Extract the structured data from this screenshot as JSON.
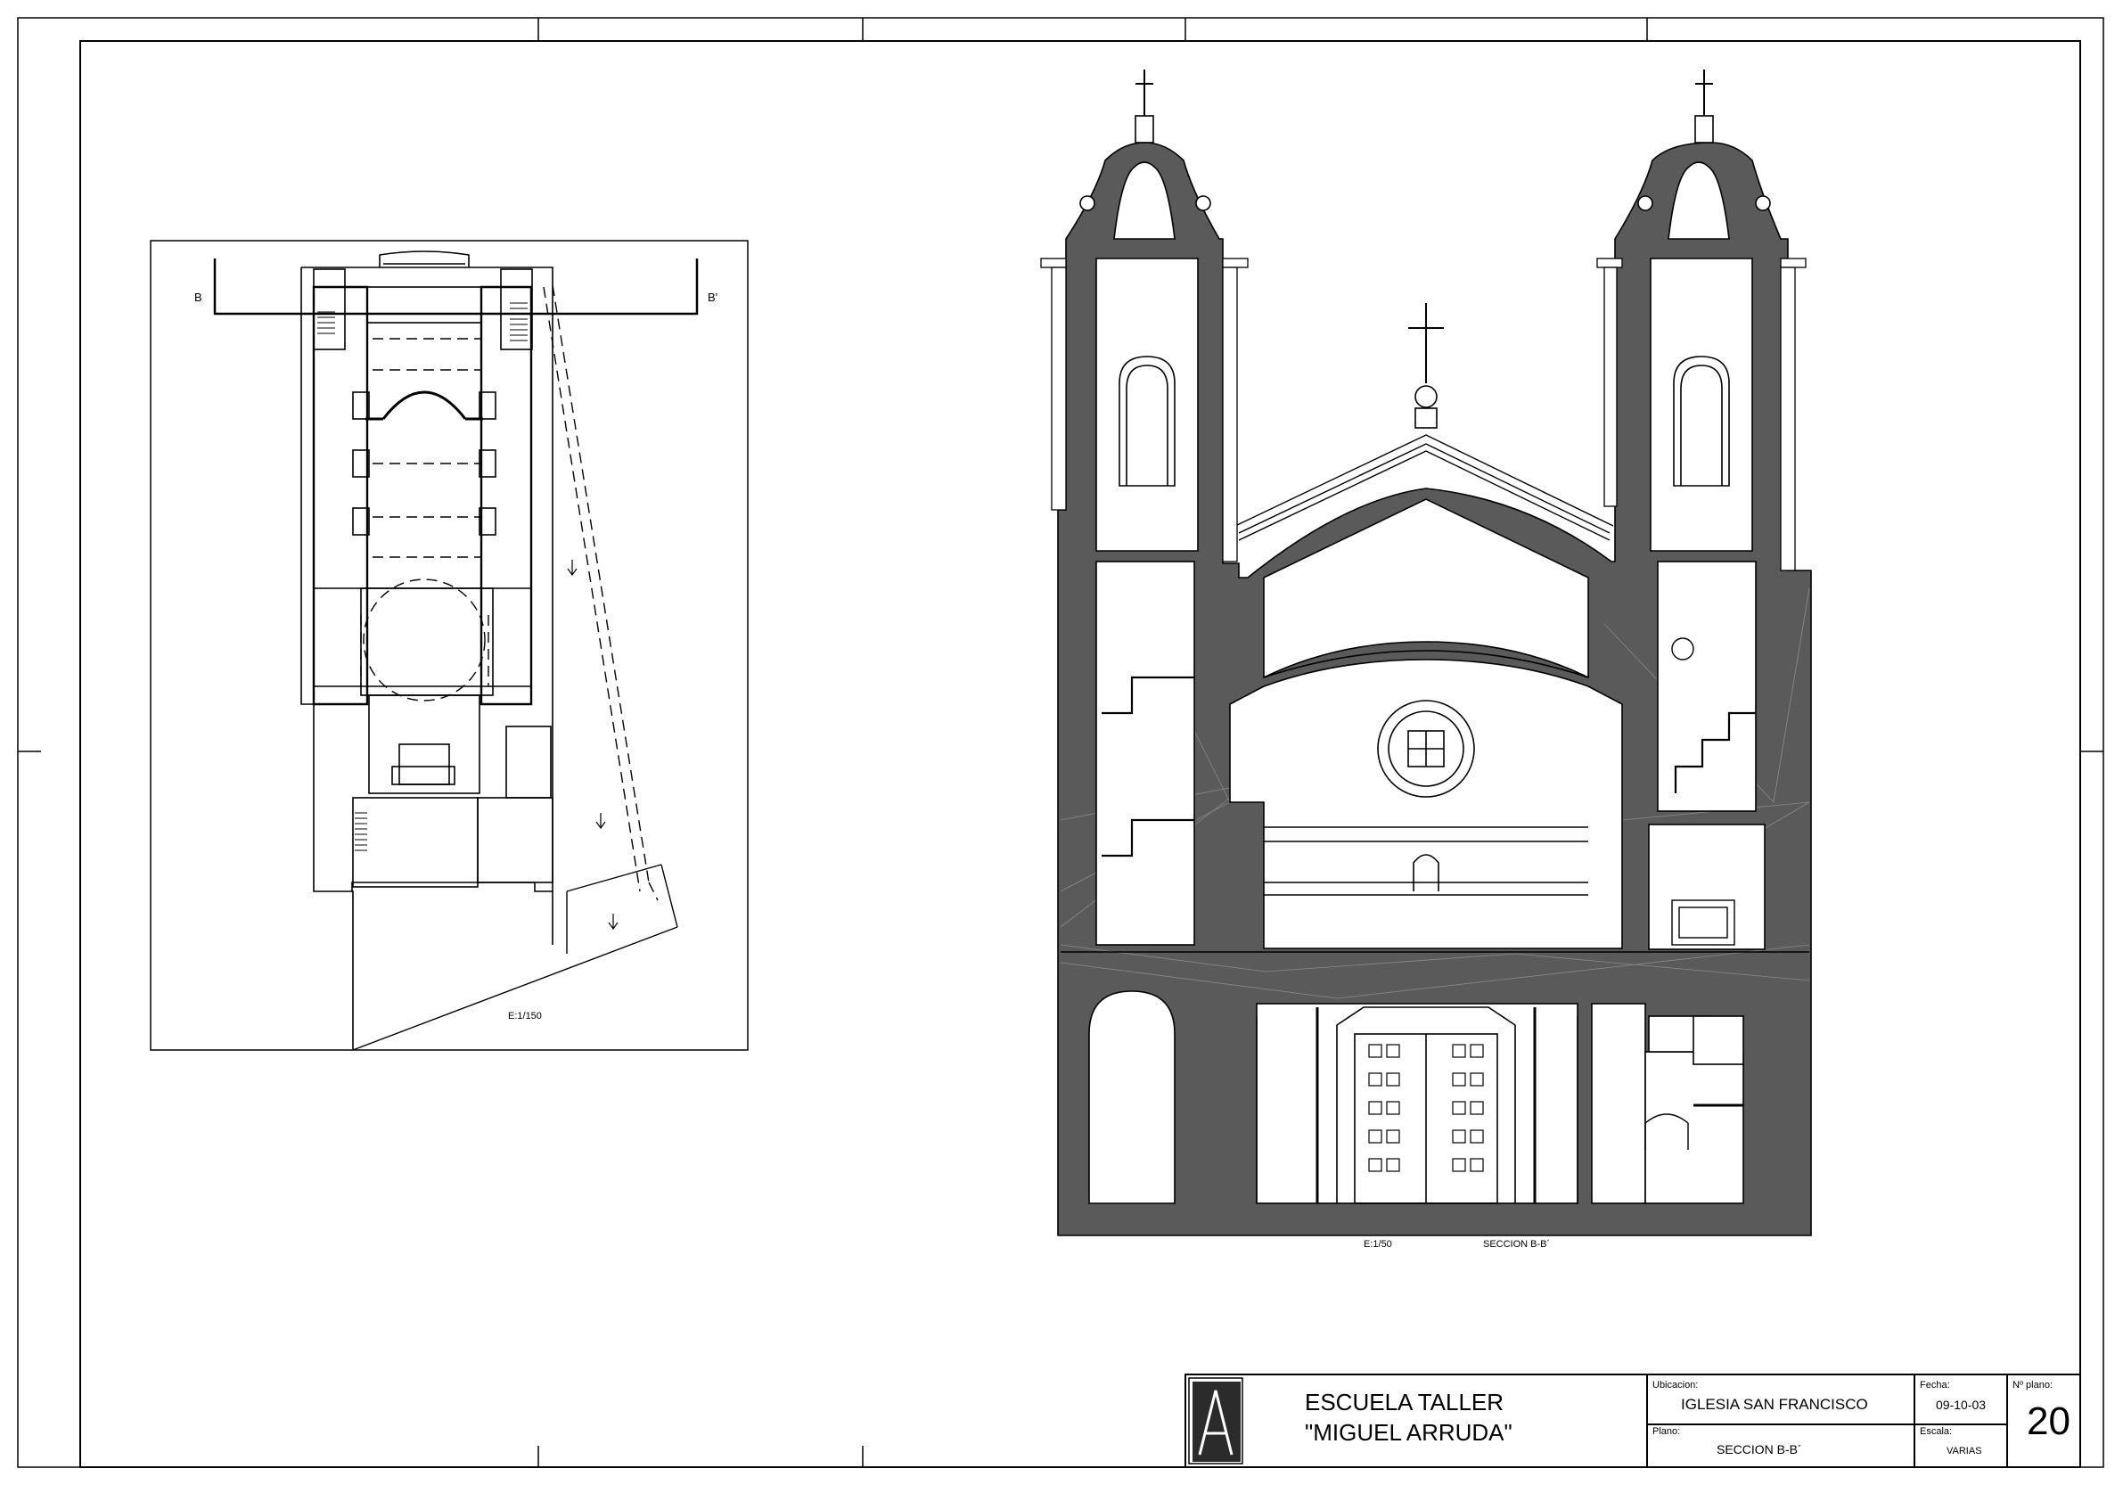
{
  "plan": {
    "cut_label_left": "B",
    "cut_label_right": "B'",
    "scale": "E:1/150"
  },
  "section": {
    "scale": "E:1/50",
    "caption": "SECCION B-B´"
  },
  "title_block": {
    "school_line1": "ESCUELA TALLER",
    "school_line2": "\"MIGUEL ARRUDA\"",
    "ubicacion_label": "Ubicacion:",
    "ubicacion_value": "IGLESIA SAN FRANCISCO",
    "plano_label": "Plano:",
    "plano_value": "SECCION B-B´",
    "fecha_label": "Fecha:",
    "fecha_value": "09-10-03",
    "escala_label": "Escala:",
    "escala_value": "VARIAS",
    "numero_label": "Nº plano:",
    "numero_value": "20",
    "logo_letter": "A"
  },
  "colors": {
    "wall_fill": "#5a5a5a",
    "line": "#000000",
    "paper": "#ffffff"
  }
}
